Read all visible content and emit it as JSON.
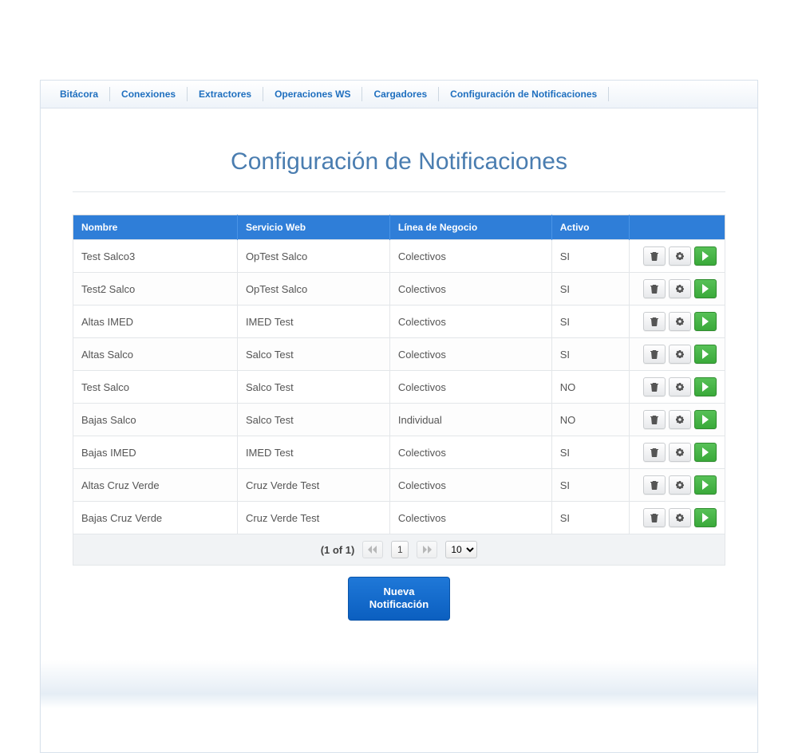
{
  "tabs": [
    {
      "label": "Bitácora"
    },
    {
      "label": "Conexiones"
    },
    {
      "label": "Extractores"
    },
    {
      "label": "Operaciones WS"
    },
    {
      "label": "Cargadores"
    },
    {
      "label": "Configuración de Notificaciones"
    }
  ],
  "page_title": "Configuración de Notificaciones",
  "table": {
    "headers": [
      "Nombre",
      "Servicio Web",
      "Línea de Negocio",
      "Activo",
      ""
    ],
    "rows": [
      {
        "nombre": "Test Salco3",
        "servicio": "OpTest Salco",
        "linea": "Colectivos",
        "activo": "SI"
      },
      {
        "nombre": "Test2 Salco",
        "servicio": "OpTest Salco",
        "linea": "Colectivos",
        "activo": "SI"
      },
      {
        "nombre": "Altas IMED",
        "servicio": "IMED Test",
        "linea": "Colectivos",
        "activo": "SI"
      },
      {
        "nombre": "Altas Salco",
        "servicio": "Salco Test",
        "linea": "Colectivos",
        "activo": "SI"
      },
      {
        "nombre": "Test Salco",
        "servicio": "Salco Test",
        "linea": "Colectivos",
        "activo": "NO"
      },
      {
        "nombre": "Bajas Salco",
        "servicio": "Salco Test",
        "linea": "Individual",
        "activo": "NO"
      },
      {
        "nombre": "Bajas IMED",
        "servicio": "IMED Test",
        "linea": "Colectivos",
        "activo": "SI"
      },
      {
        "nombre": "Altas Cruz Verde",
        "servicio": "Cruz Verde Test",
        "linea": "Colectivos",
        "activo": "SI"
      },
      {
        "nombre": "Bajas Cruz Verde",
        "servicio": "Cruz Verde Test",
        "linea": "Colectivos",
        "activo": "SI"
      }
    ]
  },
  "paginator": {
    "summary": "(1 of 1)",
    "current_page": "1",
    "rows_per_page": "10"
  },
  "new_button": "Nueva\nNotificación"
}
